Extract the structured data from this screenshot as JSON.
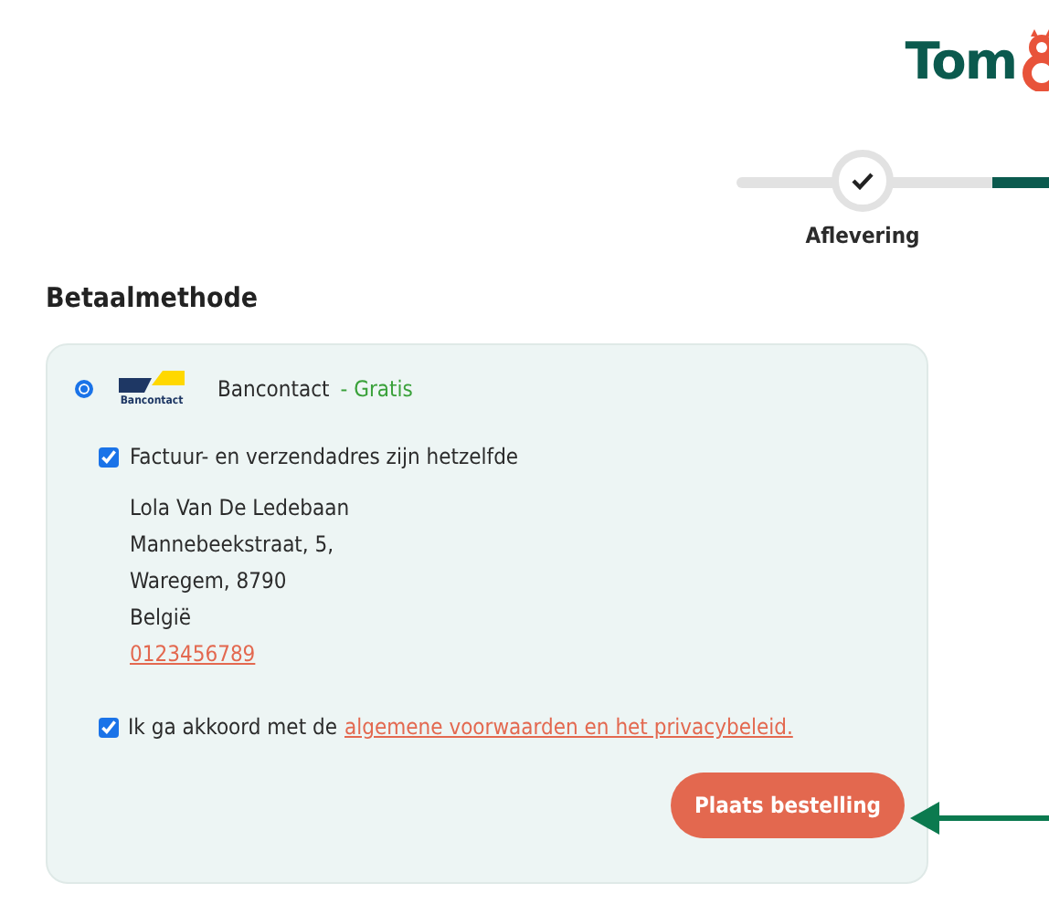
{
  "header": {
    "logo_text": "Tom"
  },
  "progress": {
    "steps": [
      {
        "label": "Aflevering",
        "completed": true
      }
    ]
  },
  "payment": {
    "heading": "Betaalmethode",
    "methods": [
      {
        "logo_caption": "Bancontact",
        "name": "Bancontact",
        "price": "- Gratis",
        "selected": true
      }
    ],
    "same_address": {
      "label": "Factuur- en verzendadres zijn hetzelfde",
      "checked": true
    },
    "address": [
      "Lola Van De Ledebaan",
      "Mannebeekstraat, 5,",
      "Waregem, 8790",
      "België"
    ],
    "phone": "0123456789",
    "terms": {
      "text": "Ik ga akkoord met de",
      "link": "algemene voorwaarden en het privacybeleid.",
      "checked": true
    },
    "submit": "Plaats bestelling"
  }
}
